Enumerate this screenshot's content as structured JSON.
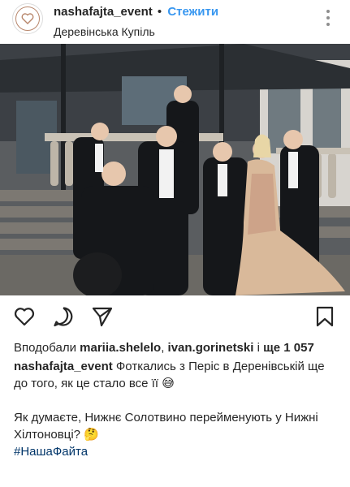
{
  "header": {
    "username": "nashafajta_event",
    "separator": "•",
    "follow_label": "Стежити",
    "location": "Деревінська Купіль",
    "more_icon": "more-vertical-icon"
  },
  "actions": {
    "like_icon": "heart-icon",
    "comment_icon": "comment-icon",
    "share_icon": "send-icon",
    "save_icon": "bookmark-icon"
  },
  "likes": {
    "prefix": "Вподобали",
    "user1": "mariia.shelelo",
    "sep": ",",
    "user2": "ivan.gorinetski",
    "conj": "і",
    "count_text": "ще 1 057"
  },
  "caption": {
    "username": "nashafajta_event",
    "line1": "Фоткались з Періс в Деренівській ще до того, як це стало все її 😅",
    "line2": "Як думаєте, Нижнє Солотвино перейменують у Нижні Хілтоновці? 🤔",
    "hashtag": "#НашаФайта"
  },
  "colors": {
    "link_blue": "#3897f0",
    "hashtag": "#003569",
    "text": "#262626"
  }
}
